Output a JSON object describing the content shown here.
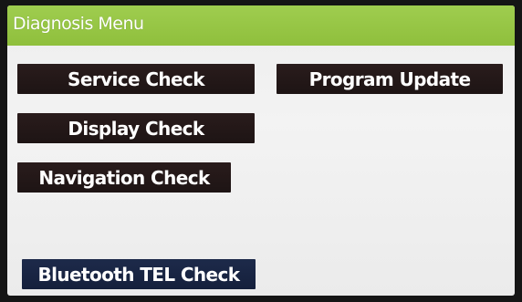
{
  "window": {
    "title": "Diagnosis Menu"
  },
  "menu": {
    "service_check": "Service Check",
    "display_check": "Display Check",
    "navigation_check": "Navigation Check",
    "bluetooth_tel_check": "Bluetooth TEL Check",
    "program_update": "Program Update"
  },
  "colors": {
    "title_bar": "#9fcd4f",
    "button_dark": "#231818",
    "button_blue": "#1b2747",
    "screen_bg": "#efefef"
  }
}
